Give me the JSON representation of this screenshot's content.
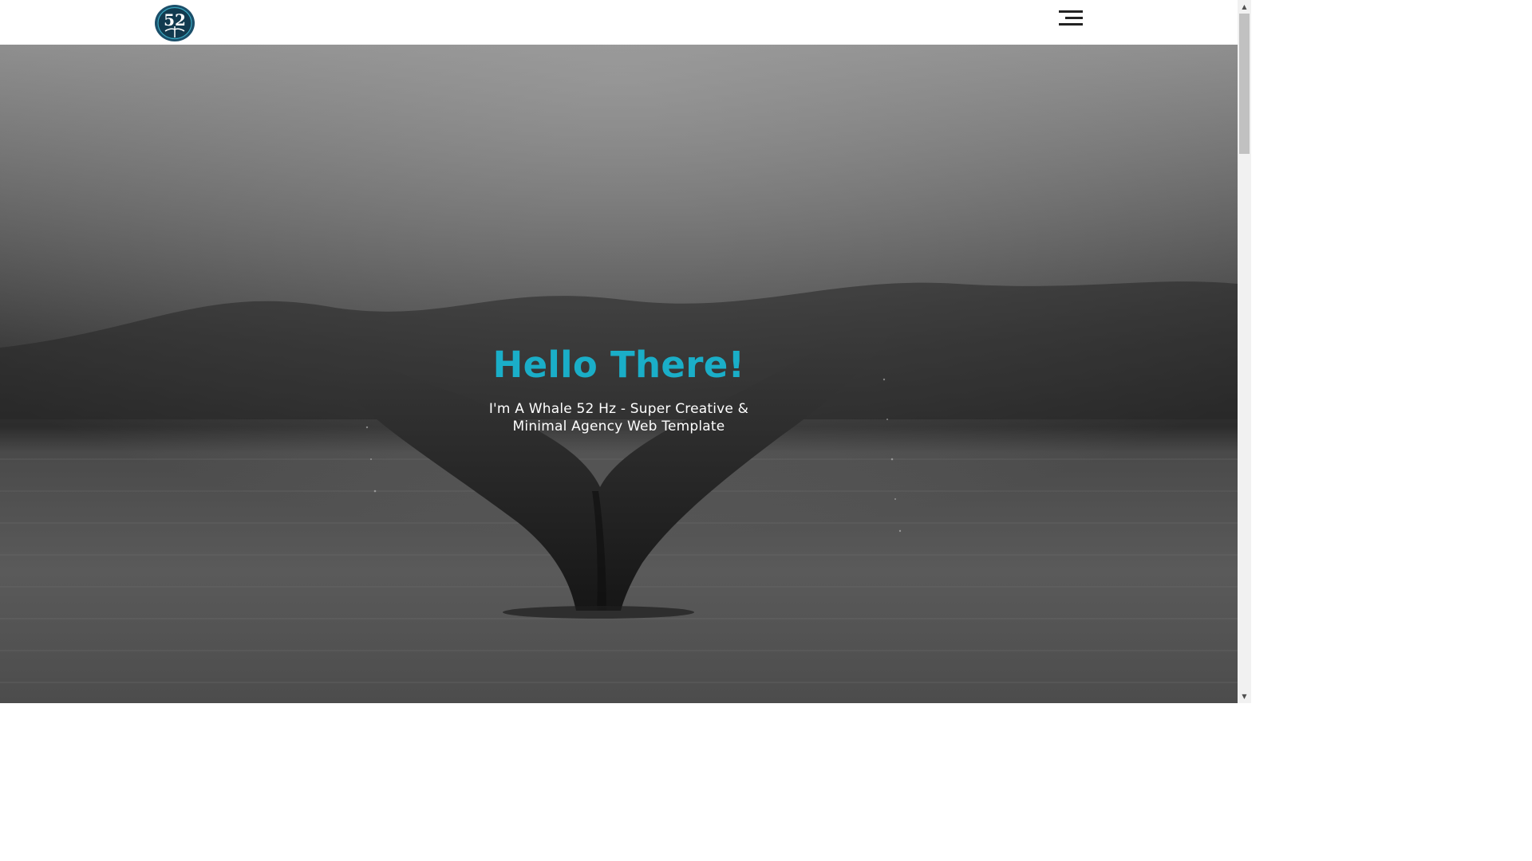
{
  "header": {
    "logo_alt": "52",
    "menu_icon": "hamburger-menu-icon"
  },
  "hero": {
    "background": "black-and-white whale tail in misty water",
    "title": "Hello There!",
    "subtitle": "I'm A Whale 52 Hz - Super Creative & Minimal Agency Web Template"
  },
  "colors": {
    "accent": "#1aaec8",
    "logo_ring": "#1b4f6a",
    "navbar_bg": "#ffffff",
    "menu_icon": "#222222",
    "subtitle": "#ffffff"
  },
  "scrollbar": {
    "up_arrow": "▲",
    "down_arrow": "▼"
  }
}
